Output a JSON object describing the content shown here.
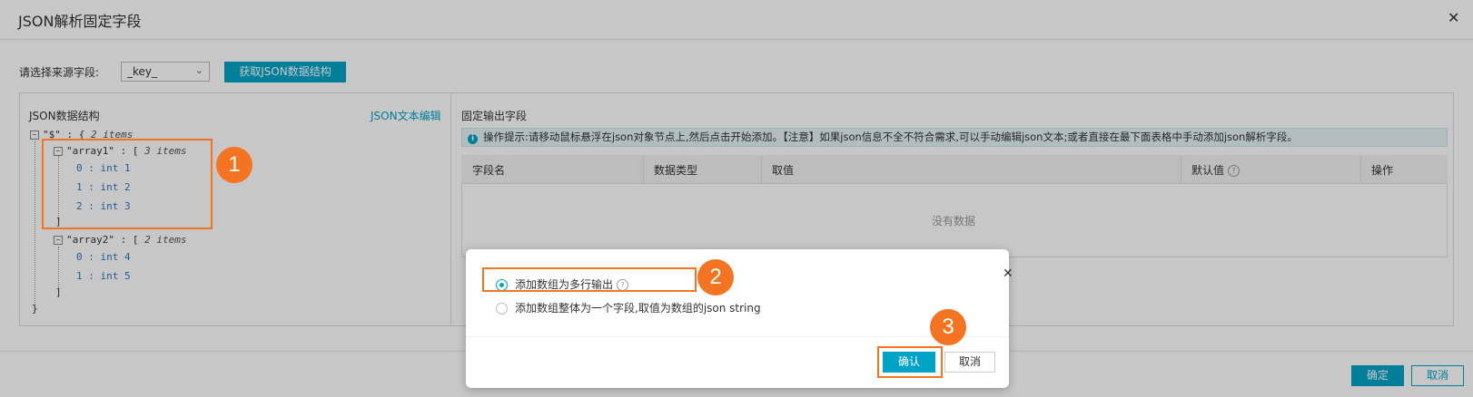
{
  "dialog": {
    "title": "JSON解析固定字段",
    "source_label": "请选择来源字段:",
    "source_value": "_key_",
    "fetch_button": "获取JSON数据结构",
    "ok_button": "确定",
    "cancel_button": "取消"
  },
  "left_panel": {
    "title": "JSON数据结构",
    "edit_link": "JSON文本编辑",
    "tree": {
      "root": "\"$\" : {",
      "root_count": "2 items",
      "array1_key": "\"array1\" : [",
      "array1_count": "3 items",
      "array1_items": [
        {
          "idx": "0 :",
          "val": "int 1"
        },
        {
          "idx": "1 :",
          "val": "int 2"
        },
        {
          "idx": "2 :",
          "val": "int 3"
        }
      ],
      "array1_close": "]",
      "array2_key": "\"array2\" : [",
      "array2_count": "2 items",
      "array2_items": [
        {
          "idx": "0 :",
          "val": "int 4"
        },
        {
          "idx": "1 :",
          "val": "int 5"
        }
      ],
      "array2_close": "]",
      "root_close": "}"
    }
  },
  "right_panel": {
    "title": "固定输出字段",
    "tip": "操作提示:请移动鼠标悬浮在json对象节点上,然后点击开始添加。【注意】如果json信息不全不符合需求,可以手动编辑json文本;或者直接在最下面表格中手动添加json解析字段。",
    "columns": [
      "字段名",
      "数据类型",
      "取值",
      "默认值",
      "操作"
    ],
    "empty_text": "没有数据"
  },
  "modal": {
    "option1": "添加数组为多行输出",
    "option2": "添加数组整体为一个字段,取值为数组的json string",
    "ok": "确认",
    "cancel": "取消"
  },
  "badges": [
    "1",
    "2",
    "3"
  ],
  "colors": {
    "accent": "#00a2c6",
    "highlight": "#f47421"
  }
}
